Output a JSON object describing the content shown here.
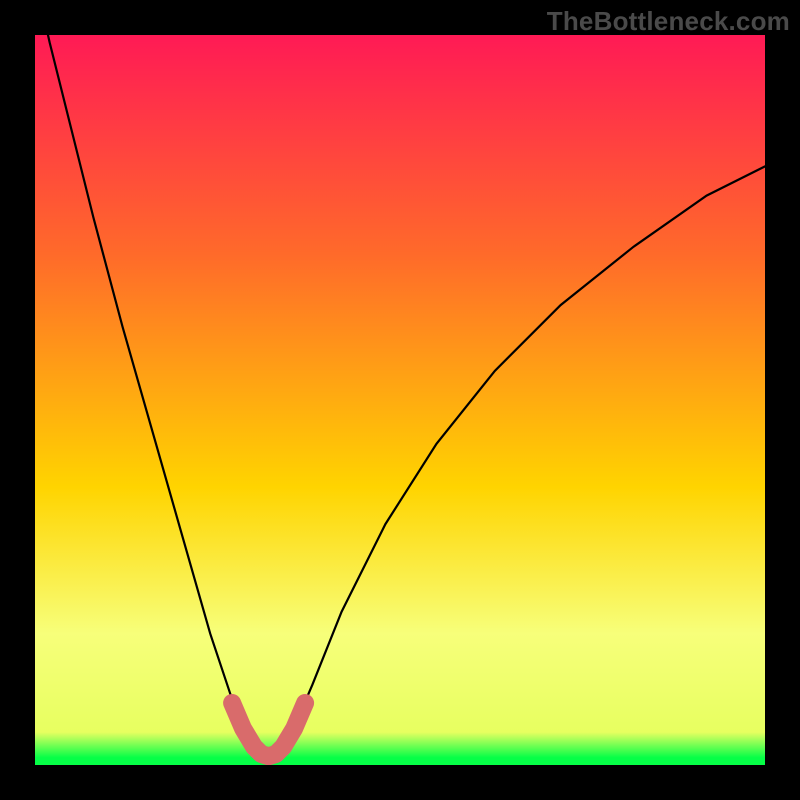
{
  "watermark": "TheBottleneck.com",
  "colors": {
    "frame": "#000000",
    "grad_top": "#ff1a55",
    "grad_upper": "#ff6a2a",
    "grad_mid": "#ffd400",
    "grad_band": "#f7ff7a",
    "grad_bottom": "#06ff47",
    "curve": "#000000",
    "highlight": "#d96b6b"
  },
  "chart_data": {
    "type": "line",
    "title": "",
    "xlabel": "",
    "ylabel": "",
    "xlim": [
      0,
      100
    ],
    "ylim": [
      0,
      100
    ],
    "series": [
      {
        "name": "bottleneck-curve",
        "x": [
          0,
          2,
          5,
          8,
          12,
          16,
          20,
          24,
          27,
          29,
          30.5,
          32,
          33.5,
          35,
          38,
          42,
          48,
          55,
          63,
          72,
          82,
          92,
          100
        ],
        "y": [
          108,
          99,
          87,
          75,
          60,
          46,
          32,
          18,
          9,
          4,
          1.5,
          1,
          1.5,
          4,
          11,
          21,
          33,
          44,
          54,
          63,
          71,
          78,
          82
        ]
      },
      {
        "name": "highlight-u",
        "x": [
          27,
          28.5,
          30,
          31,
          32,
          33,
          34,
          35.5,
          37
        ],
        "y": [
          8.5,
          5,
          2.5,
          1.5,
          1.2,
          1.5,
          2.5,
          5,
          8.5
        ]
      }
    ],
    "gradient_stops": [
      {
        "offset": 0.0,
        "color": "#ff1a55"
      },
      {
        "offset": 0.3,
        "color": "#ff6a2a"
      },
      {
        "offset": 0.62,
        "color": "#ffd400"
      },
      {
        "offset": 0.82,
        "color": "#f7ff7a"
      },
      {
        "offset": 0.955,
        "color": "#e7ff60"
      },
      {
        "offset": 0.99,
        "color": "#06ff47"
      },
      {
        "offset": 1.0,
        "color": "#06ff47"
      }
    ]
  }
}
